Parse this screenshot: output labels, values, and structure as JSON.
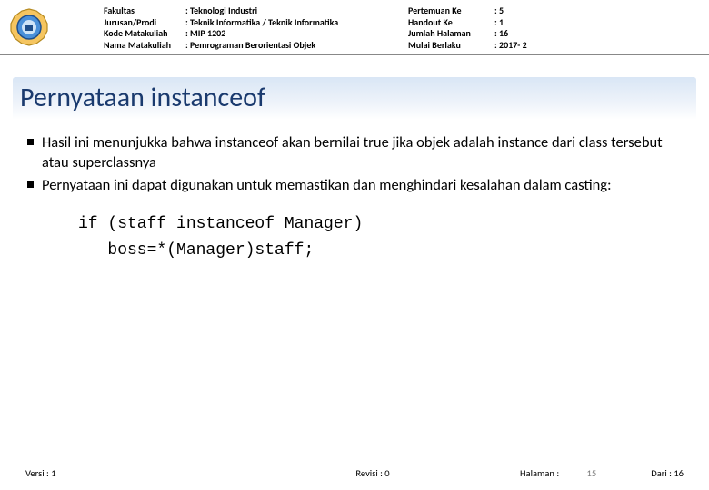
{
  "header": {
    "left_labels": {
      "r1": "Fakultas",
      "r2": "Jurusan/Prodi",
      "r3": "Kode Matakuliah",
      "r4": "Nama Matakuliah"
    },
    "left_values": {
      "r1": ": Teknologi Industri",
      "r2": ": Teknik Informatika / Teknik Informatika",
      "r3": ": MIP 1202",
      "r4": ": Pemrograman Berorientasi Objek"
    },
    "right_labels": {
      "r1": "Pertemuan Ke",
      "r2": "Handout Ke",
      "r3": "Jumlah Halaman",
      "r4": "Mulai Berlaku"
    },
    "right_values": {
      "r1": ": 5",
      "r2": ": 1",
      "r3": ": 16",
      "r4": ": 2017- 2"
    }
  },
  "section_title": "Pernyataan instanceof",
  "bullets": {
    "b1": "Hasil ini menunjukka bahwa instanceof akan bernilai true jika objek adalah instance dari class tersebut atau superclassnya",
    "b2": "Pernyataan ini dapat digunakan untuk memastikan dan menghindari kesalahan dalam casting:"
  },
  "code": "if (staff instanceof Manager)\n   boss=*(Manager)staff;",
  "footer": {
    "versi": "Versi : 1",
    "revisi": "Revisi : 0",
    "halaman_label": "Halaman :",
    "halaman_num": "15",
    "dari": "Dari : 16"
  }
}
